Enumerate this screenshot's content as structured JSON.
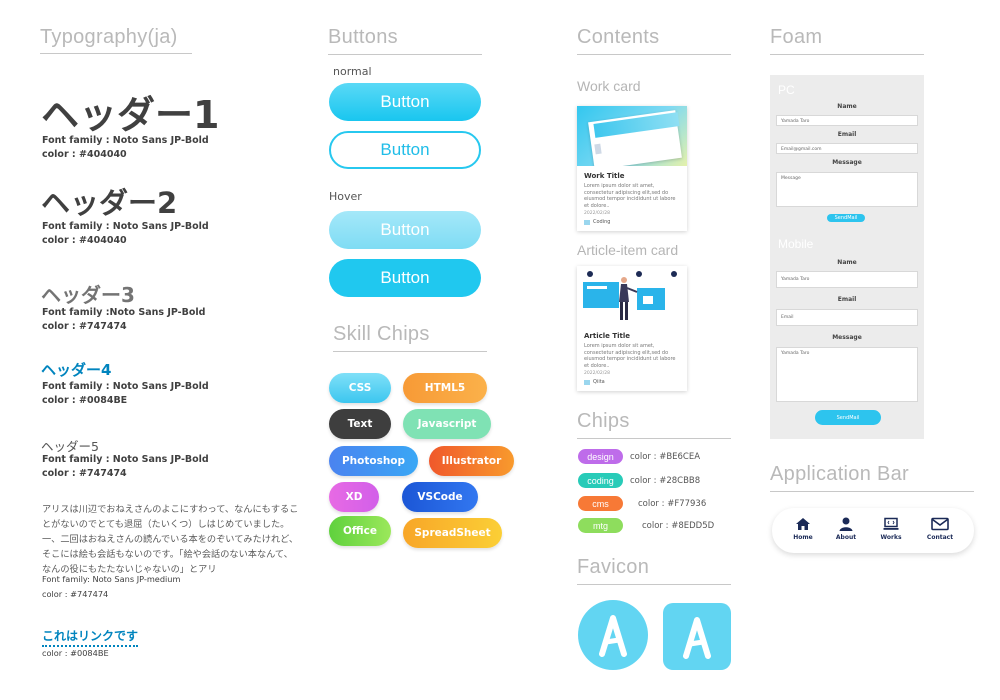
{
  "typography": {
    "title": "Typography(ja)",
    "h1": "ヘッダー1",
    "h1_meta1": "Font family : Noto Sans JP-Bold",
    "h1_meta2": "color : #404040",
    "h2": "ヘッダー2",
    "h2_meta1": "Font family : Noto Sans JP-Bold",
    "h2_meta2": "color : #404040",
    "h3": "ヘッダー3",
    "h3_meta1": "Font family :Noto Sans JP-Bold",
    "h3_meta2": "color : #747474",
    "h4": "ヘッダー4",
    "h4_meta1": "Font family : Noto Sans JP-Bold",
    "h4_meta2": "color : #0084BE",
    "h5": "ヘッダー5",
    "h5_meta1": "Font family : Noto Sans JP-Bold",
    "h5_meta2": "color : #747474",
    "paragraph": "アリスは川辺でおねえさんのよこにすわって、なんにもすることがないのでとても退屈（たいくつ）しはじめていました。一、二回はおねえさんの読んでいる本をのぞいてみたけれど、そこには絵も会話もないのです。「絵や会話のない本なんて、なんの役にもたたないじゃないの」とアリ",
    "para_meta1": "Font family: Noto Sans JP-medium",
    "para_meta2": "color : #747474",
    "link_text": "これはリンクです",
    "link_meta": "color : #0084BE"
  },
  "buttons": {
    "title": "Buttons",
    "normal_label": "normal",
    "hover_label": "Hover",
    "labels": [
      "Button",
      "Button",
      "Button",
      "Button"
    ]
  },
  "skill_chips": {
    "title": "Skill Chips",
    "items": [
      "CSS",
      "HTML5",
      "Text",
      "Javascript",
      "Photoshop",
      "Illustrator",
      "XD",
      "VSCode",
      "Office",
      "SpreadSheet"
    ]
  },
  "contents": {
    "title": "Contents",
    "work_card_label": "Work card",
    "work_card": {
      "title": "Work Title",
      "text": "Lorem ipsum dolor sit amet, consectetur adipiscing elit,sed do eiusmod tempor incididunt ut labore et dolore..",
      "date": "2022/02/28",
      "tag": "Coding"
    },
    "article_card_label": "Article-item card",
    "article_card": {
      "title": "Article Title",
      "text": "Lorem ipsum dolor sit amet, consectetur adipiscing elit,sed do eiusmod tempor incididunt ut labore et dolore..",
      "date": "2022/02/28",
      "tag": "Qiita"
    },
    "chips_title": "Chips",
    "chips": [
      {
        "name": "design",
        "color_label": "color : #BE6CEA",
        "color": "#BE6CEA"
      },
      {
        "name": "coding",
        "color_label": "color : #28CBB8",
        "color": "#28CBB8"
      },
      {
        "name": "cms",
        "color_label": "color : #F77936",
        "color": "#F77936"
      },
      {
        "name": "mtg",
        "color_label": "color : #8EDD5D",
        "color": "#8EDD5D"
      }
    ],
    "favicon_title": "Favicon"
  },
  "form": {
    "title": "Foam",
    "pc_label": "PC",
    "mobile_label": "Mobile",
    "name_label": "Name",
    "email_label": "Email",
    "message_label": "Message",
    "pc_name_value": "Yamada Taro",
    "pc_email_value": "Email@gmail.com",
    "pc_message_value": "Message",
    "pc_button": "SendMail",
    "mobile_name_value": "Yamada Taro",
    "mobile_email_value": "Email",
    "mobile_message_value": "Yamada Taro",
    "mobile_button": "SendMail"
  },
  "app_bar": {
    "title": "Application Bar",
    "items": [
      {
        "label": "Home",
        "icon": "home-icon"
      },
      {
        "label": "About",
        "icon": "user-icon"
      },
      {
        "label": "Works",
        "icon": "laptop-icon"
      },
      {
        "label": "Contact",
        "icon": "mail-icon"
      }
    ]
  },
  "colors": {
    "heading": "#404040",
    "sub": "#747474",
    "link": "#0084BE",
    "accent": "#20c8ef"
  }
}
